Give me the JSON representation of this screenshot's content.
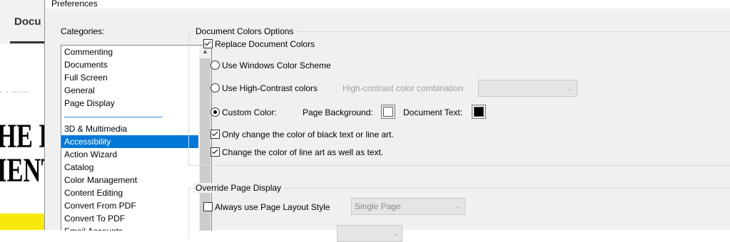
{
  "background_app": {
    "tab_label": "Docu",
    "doc_faint_text": "- - ------",
    "doc_big_line1": "HE E",
    "doc_big_line2": "IENT"
  },
  "dialog": {
    "title": "Preferences"
  },
  "categories": {
    "label": "Categories:",
    "group1": [
      "Commenting",
      "Documents",
      "Full Screen",
      "General",
      "Page Display"
    ],
    "group2": [
      "3D & Multimedia",
      "Accessibility",
      "Action Wizard",
      "Catalog",
      "Color Management",
      "Content Editing",
      "Convert From PDF",
      "Convert To PDF",
      "Email Accounts"
    ],
    "selected": "Accessibility",
    "scroll_up_icon": "chevron-up-icon"
  },
  "document_colors": {
    "title": "Document Colors Options",
    "replace_label": "Replace Document Colors",
    "replace_checked": true,
    "windows_scheme_label": "Use Windows Color Scheme",
    "high_contrast_label": "Use High-Contrast colors",
    "high_contrast_combo_label": "High-contrast color combination:",
    "high_contrast_combo_value": "",
    "custom_color_label": "Custom Color:",
    "selected_radio": "custom",
    "page_background_label": "Page Background:",
    "page_background_color": "#ffffff",
    "document_text_label": "Document Text:",
    "document_text_color": "#000000",
    "only_black_label": "Only change the color of black text or line art.",
    "only_black_checked": true,
    "line_art_label": "Change the color of line art as well as text.",
    "line_art_checked": true
  },
  "override_page_display": {
    "title": "Override Page Display",
    "always_layout_label": "Always use Page Layout Style",
    "always_layout_checked": false,
    "layout_value": "Single Page"
  },
  "colors": {
    "selection": "#0078d7",
    "dialog_bg": "#f0f0f0",
    "bg_yellow": "#f6e90b"
  }
}
